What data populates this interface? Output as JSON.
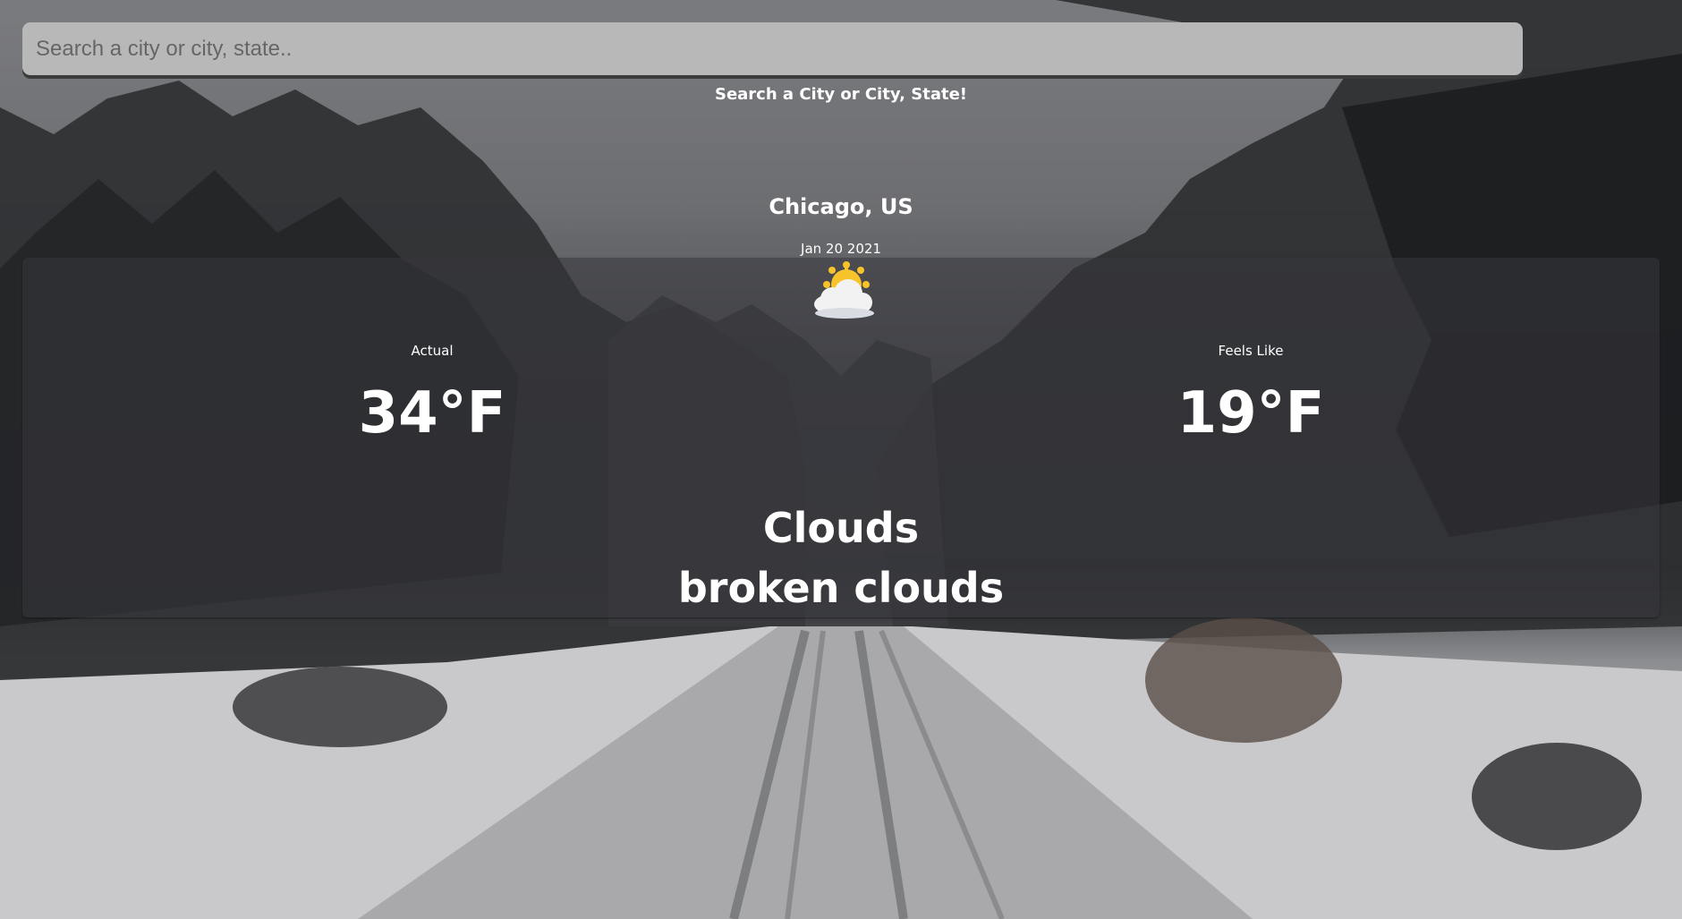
{
  "search": {
    "placeholder": "Search a city or city, state..",
    "value": "",
    "hint": "Search a City or City, State!"
  },
  "location": {
    "name": "Chicago, US",
    "date": "Jan 20 2021"
  },
  "weather": {
    "icon": "partly-cloudy-icon",
    "actual_label": "Actual",
    "actual_temp": "34°F",
    "feels_like_label": "Feels Like",
    "feels_like_temp": "19°F",
    "condition": "Clouds",
    "description": "broken clouds"
  },
  "colors": {
    "text": "#ffffff",
    "search_bg": "#b8b8b8",
    "sun": "#f6c32b",
    "cloud": "#f2f2f2"
  }
}
